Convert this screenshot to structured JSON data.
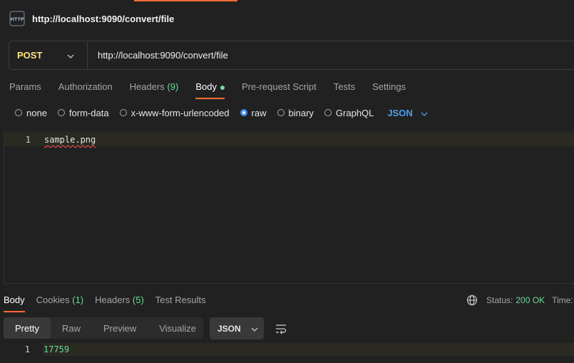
{
  "request": {
    "title": "http://localhost:9090/convert/file",
    "method": "POST",
    "url": "http://localhost:9090/convert/file"
  },
  "request_tabs": {
    "params": "Params",
    "authorization": "Authorization",
    "headers": "Headers",
    "headers_count": "(9)",
    "body": "Body",
    "prerequest": "Pre-request Script",
    "tests": "Tests",
    "settings": "Settings"
  },
  "body_types": {
    "none": "none",
    "form_data": "form-data",
    "urlencoded": "x-www-form-urlencoded",
    "raw": "raw",
    "binary": "binary",
    "graphql": "GraphQL",
    "format": "JSON",
    "selected": "raw"
  },
  "editor": {
    "line_number": "1",
    "content": "sample.png"
  },
  "response_tabs": {
    "body": "Body",
    "cookies": "Cookies",
    "cookies_count": "(1)",
    "headers": "Headers",
    "headers_count": "(5)",
    "test_results": "Test Results"
  },
  "status": {
    "label": "Status:",
    "value": "200 OK",
    "time_label": "Time:"
  },
  "response_view": {
    "pretty": "Pretty",
    "raw": "Raw",
    "preview": "Preview",
    "visualize": "Visualize",
    "format": "JSON"
  },
  "response": {
    "line_number": "1",
    "content": "17759"
  },
  "colors": {
    "accent": "#ff6c37",
    "method": "#ffe47e",
    "success": "#6bdd9a",
    "link": "#4d9df0"
  }
}
